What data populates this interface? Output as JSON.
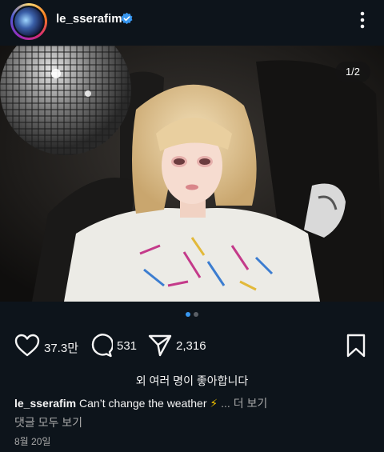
{
  "post": {
    "username": "le_sserafim",
    "image_counter": "1/2",
    "likes_count": "37.3만",
    "comments_count": "531",
    "shares_count": "2,316",
    "liked_by_text": "외 여러 명이 좋아합니다",
    "caption_text": "Can’t change the weather",
    "caption_emoji": "⚡",
    "caption_more": "... 더 보기",
    "view_all_comments": "댓글 모두 보기",
    "date": "8월 20일",
    "carousel": {
      "total": 2,
      "active": 1
    }
  },
  "icons": {
    "verified": "verified-badge-icon",
    "more": "more-options-icon",
    "like": "heart-icon",
    "comment": "comment-icon",
    "share": "paper-plane-icon",
    "save": "bookmark-icon"
  },
  "colors": {
    "background": "#0d141b",
    "verified_blue": "#3897f0",
    "active_dot": "#3897f0",
    "secondary_text": "#a8a8a8"
  }
}
